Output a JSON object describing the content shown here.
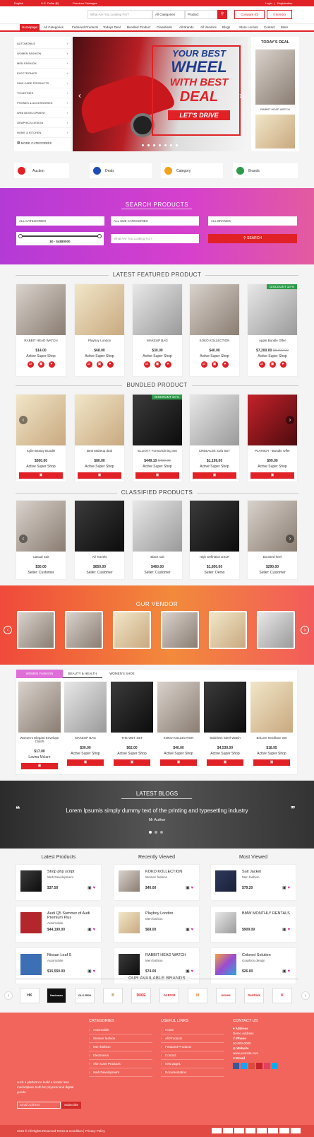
{
  "topbar": {
    "language": "English",
    "currency": "U.S. Dollar ($)",
    "packages": "Premium Packages",
    "login": "Login",
    "sep": "|",
    "register": "Registration"
  },
  "header": {
    "search_placeholder": "What Are You Looking For?",
    "category": "All Categories",
    "type": "Product",
    "compare": "Compare (0)",
    "cart": "0 item(s)"
  },
  "nav": [
    "Homepage",
    "All Categories",
    "Featured Products",
    "Todays Deal",
    "Bundled Product",
    "Classifieds",
    "All Brands",
    "All Vendors",
    "Blogs",
    "Store Locator",
    "Contact",
    "More"
  ],
  "sidebar": {
    "items": [
      "AUTOMOBILE",
      "WOMEN FASHION",
      "MEN FASHION",
      "ELECTRONICS",
      "SKIN CARE PRODUCTS",
      "TOILETRIES",
      "PHONES & ACCESSORIES",
      "WEB DEVELOPMENT",
      "GRAPHICS DESIGN",
      "HOME & KITCHEN"
    ],
    "more": "MORE CATEGORIES"
  },
  "hero": {
    "line1": "YOUR BEST",
    "line2": "WHEEL",
    "line3": "WITH BEST",
    "line4": "DEAL",
    "line5": "LET'S DRIVE"
  },
  "todays_deal": {
    "title": "TODAY'S DEAL",
    "item": "RABBIT HEAD WATCH"
  },
  "quicklinks": [
    {
      "label": "Auction",
      "color": "#e02227"
    },
    {
      "label": "Deals",
      "color": "#1f4db3"
    },
    {
      "label": "Category",
      "color": "#f2a21b"
    },
    {
      "label": "Brands",
      "color": "#2c9b48"
    }
  ],
  "search_products": {
    "title": "SEARCH PRODUCTS",
    "cat": "ALL CATEGORIES",
    "subcat": "ALL SUB CATEGORIES",
    "brands": "ALL BRANDS",
    "range": "$0 - $4880000",
    "placeholder": "What Are You Looking For?",
    "button": "SEARCH"
  },
  "featured": {
    "title": "LATEST FEATURED PRODUCT",
    "items": [
      {
        "name": "RABBIT HEAD WATCH",
        "price": "$14.00",
        "shop": "Active Super Shop"
      },
      {
        "name": "Playboy London",
        "price": "$68.00",
        "shop": "Active Super Shop"
      },
      {
        "name": "MAKEUP BAG",
        "price": "$30.00",
        "shop": "Active Super Shop"
      },
      {
        "name": "KOKO KOLLECTION",
        "price": "$40.00",
        "shop": "Active Super Shop"
      },
      {
        "name": "Apple Bundle Offer",
        "price": "$7,200.00",
        "old": "$8,000.00",
        "shop": "Active Super Shop",
        "discount": "DISCOUNT 10 %"
      }
    ]
  },
  "bundled": {
    "title": "BUNDLED PRODUCT",
    "items": [
      {
        "name": "Kylie Beauty Bundle",
        "price": "$300.00",
        "shop": "Active Super Shop"
      },
      {
        "name": "Best Makeup deal",
        "price": "$80.00",
        "shop": "Active Super Shop"
      },
      {
        "name": "ELLIOTT Formal Dining Set",
        "price": "$449.10",
        "old": "$499.00",
        "shop": "Active Super Shop",
        "discount": "DISCOUNT 10 %"
      },
      {
        "name": "CREEALink Sofa SET",
        "price": "$1,199.00",
        "shop": "Active Super Shop"
      },
      {
        "name": "PLAYBOY - Bundle Offer",
        "price": "$99.00",
        "shop": "Active Super Shop"
      }
    ]
  },
  "classified": {
    "title": "CLASSIFIED PRODUCTS",
    "items": [
      {
        "name": "Casual Suit",
        "price": "$30.00",
        "shop": "Seller: Customer"
      },
      {
        "name": "All Travels",
        "price": "$650.00",
        "shop": "Seller: Customer"
      },
      {
        "name": "Black suit",
        "price": "$460.00",
        "shop": "Seller: Customer"
      },
      {
        "name": "High Definition DSLR",
        "price": "$1,800.00",
        "shop": "Seller: Demo"
      },
      {
        "name": "Boosted heel",
        "price": "$290.00",
        "shop": "Seller: Customer"
      }
    ]
  },
  "vendor": {
    "title": "OUR VENDOR"
  },
  "tabs": {
    "labels": [
      "WOMEN FASHION",
      "BEAUTY & HEALTH",
      "WOMEN'S SHOE"
    ],
    "items": [
      {
        "name": "Women's Elegant Envelope Clutch",
        "price": "$17.00",
        "shop": "Lavina Mclare"
      },
      {
        "name": "MAKEUP BAG",
        "price": "$30.00",
        "shop": "Active Super Shop"
      },
      {
        "name": "THE WET SET",
        "price": "$62.00",
        "shop": "Active Super Shop"
      },
      {
        "name": "KOKO KOLLECTION",
        "price": "$40.00",
        "shop": "Active Super Shop"
      },
      {
        "name": "Stainless Steel Watch",
        "price": "$4,530.00",
        "shop": "Active Super Shop"
      },
      {
        "name": "BriLove Necklace Set",
        "price": "$18.95",
        "shop": "Active Super Shop"
      }
    ]
  },
  "blogs": {
    "title": "LATEST BLOGS",
    "quote": "Lorem Ipsumis simply dummy text of the printing and typesetting industry",
    "author": "Mr Author"
  },
  "lists": [
    {
      "title": "Latest Products",
      "items": [
        {
          "name": "Shop php script",
          "cat": "Web Development",
          "price": "$37.50"
        },
        {
          "name": "Audi Q5 Summer of Audi Premium Plus",
          "cat": "Automobile",
          "price": "$44,190.00"
        },
        {
          "name": "Nissan Leaf S",
          "cat": "Automobile",
          "price": "$15,550.00"
        }
      ]
    },
    {
      "title": "Recently Viewed",
      "items": [
        {
          "name": "KOKO KOLLECTION",
          "cat": "Women fashion",
          "price": "$40.00"
        },
        {
          "name": "Playboy London",
          "cat": "Men fashion",
          "price": "$68.00"
        },
        {
          "name": "RABBIT HEAD WATCH",
          "cat": "Men fashion",
          "price": "$74.00"
        }
      ]
    },
    {
      "title": "Most Viewed",
      "items": [
        {
          "name": "Suit Jacket",
          "cat": "Men fashion",
          "price": "$79.20"
        },
        {
          "name": "BMW MONTHLY RENTALS",
          "cat": "",
          "price": "$909.09"
        },
        {
          "name": "Colored Solution",
          "cat": "Graphics design",
          "price": "$26.00"
        }
      ]
    }
  ],
  "brands": {
    "title": "OUR AVAILABLE BRANDS",
    "items": [
      "HK",
      "Hackman",
      "GLO REN",
      "B",
      "DIXIE",
      "ALESSI",
      "M",
      "DENIM",
      "SanDisk",
      "K"
    ]
  },
  "footer": {
    "about": "such a platform to build a border less marketplace both for physical and digital goods.",
    "email_placeholder": "Email Address",
    "subscribe": "Subscribe",
    "categories_title": "CATEGORIES",
    "categories": [
      "Automobile",
      "Women fashion",
      "Men fashion",
      "Electronics",
      "Skin Care Products",
      "Web Development"
    ],
    "useful_title": "USEFUL LINKS",
    "useful": [
      "Home",
      "All Products",
      "Featured Products",
      "Contact",
      "new page1",
      "Documentation"
    ],
    "contact_title": "CONTACT US",
    "address_label": "Address",
    "address": "Demo Address",
    "phone_label": "Phone",
    "phone": "00-000-0000",
    "website_label": "Website",
    "website": "www.yoursite.com",
    "email_label": "Email",
    "copyright": "2018 © All Rights Reserved Terms & Condition | Privacy Policy"
  },
  "colors": {
    "accent": "#e02227",
    "search_band": "#c93bd8",
    "vendor_band": "#f06a3a",
    "footer": "#f2655c"
  }
}
